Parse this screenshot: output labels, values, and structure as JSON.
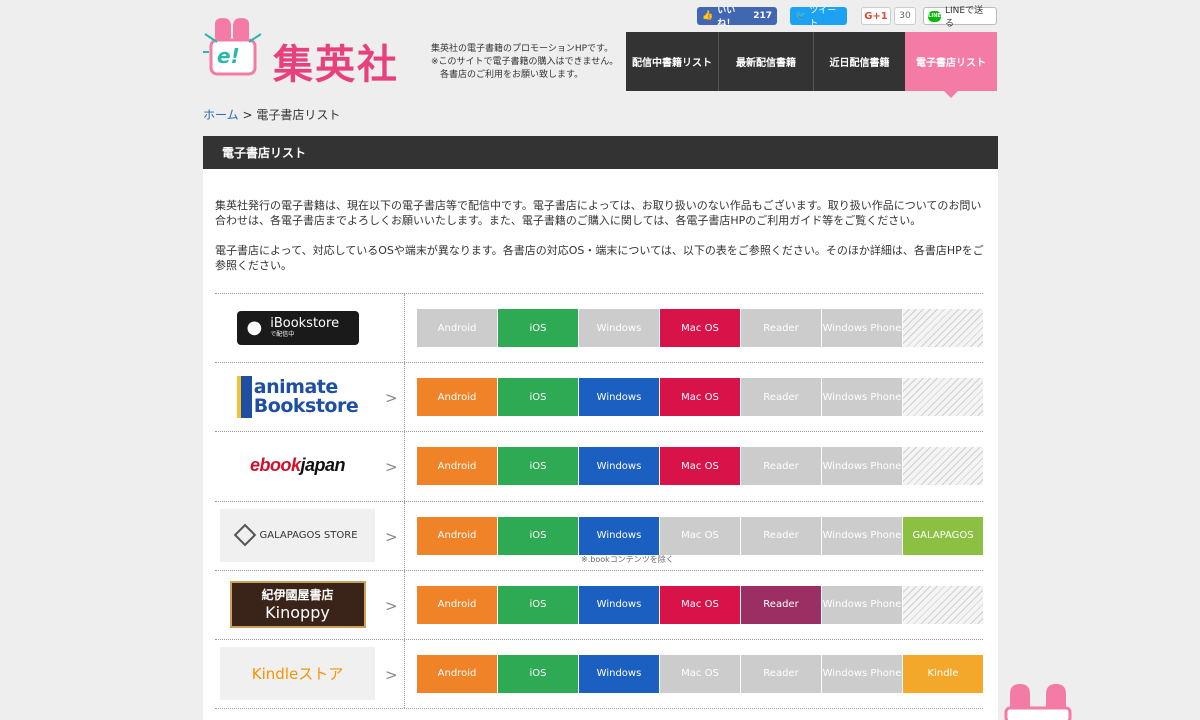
{
  "header": {
    "logo_text": "集英社",
    "logo_badge": "e!",
    "tagline": [
      "集英社の電子書籍のプロモーションHPです。",
      "※このサイトで電子書籍の購入はできません。",
      "　各書店のご利用をお願い致します。"
    ],
    "social": {
      "like_label": "いいね！",
      "like_count": "217",
      "tweet_label": "ツイート",
      "gplus_label": "G+1",
      "gplus_count": "30",
      "line_label": "LINEで送る",
      "line_badge": "LINE"
    },
    "nav": [
      {
        "label": "配信中書籍リスト",
        "width": 92
      },
      {
        "label": "最新配信書籍",
        "width": 95
      },
      {
        "label": "近日配信書籍",
        "width": 92
      },
      {
        "label": "電子書店リスト",
        "width": 92,
        "active": true
      }
    ]
  },
  "breadcrumb": {
    "home": "ホーム",
    "separator": " > ",
    "current": "電子書店リスト"
  },
  "main": {
    "section_title": "電子書店リスト",
    "intro_1": "集英社発行の電子書籍は、現在以下の電子書店等で配信中です。電子書店によっては、お取り扱いのない作品もございます。取り扱い作品についてのお問い合わせは、各電子書店までよろしくお願いいたします。また、電子書籍のご購入に関しては、各電子書店HPのご利用ガイド等をご覧ください。",
    "intro_2": "電子書店によって、対応しているOSや端末が異なります。各書店の対応OS・端末については、以下の表をご参照ください。そのほか詳細は、各書店HPをご参照ください。"
  },
  "colors": {
    "android": "#f08228",
    "ios": "#2eaa55",
    "windows": "#1b5fc1",
    "macos": "#d8134a",
    "reader": "#9b2f63",
    "disabled": "#cccccc",
    "galapagos": "#8cc043",
    "kindle": "#f3a82b",
    "accent": "#f47ba6",
    "dark": "#333333"
  },
  "stores": [
    {
      "key": "ibooks",
      "logo_line1": "iBookstore",
      "logo_line2": "で配信中",
      "has_chevron": false,
      "platforms": [
        {
          "label": "Android",
          "state": "disabled"
        },
        {
          "label": "iOS",
          "state": "ios"
        },
        {
          "label": "Windows",
          "state": "disabled"
        },
        {
          "label": "Mac OS",
          "state": "macos"
        },
        {
          "label": "Reader",
          "state": "disabled"
        },
        {
          "label": "Windows Phone",
          "state": "disabled"
        },
        {
          "label": "",
          "state": "hatch"
        }
      ]
    },
    {
      "key": "animate",
      "logo_line1": "animate",
      "logo_line2": "Bookstore",
      "has_chevron": true,
      "platforms": [
        {
          "label": "Android",
          "state": "android"
        },
        {
          "label": "iOS",
          "state": "ios"
        },
        {
          "label": "Windows",
          "state": "windows"
        },
        {
          "label": "Mac OS",
          "state": "macos"
        },
        {
          "label": "Reader",
          "state": "disabled"
        },
        {
          "label": "Windows Phone",
          "state": "disabled"
        },
        {
          "label": "",
          "state": "hatch"
        }
      ]
    },
    {
      "key": "ebookjapan",
      "logo_line1": "ebook",
      "logo_line2": "japan",
      "has_chevron": true,
      "platforms": [
        {
          "label": "Android",
          "state": "android"
        },
        {
          "label": "iOS",
          "state": "ios"
        },
        {
          "label": "Windows",
          "state": "windows"
        },
        {
          "label": "Mac OS",
          "state": "macos"
        },
        {
          "label": "Reader",
          "state": "disabled"
        },
        {
          "label": "Windows Phone",
          "state": "disabled"
        },
        {
          "label": "",
          "state": "hatch"
        }
      ]
    },
    {
      "key": "galapagos",
      "logo_line1": "GALAPAGOS STORE",
      "has_chevron": true,
      "note": "※.bookコンテンツを除く",
      "platforms": [
        {
          "label": "Android",
          "state": "android"
        },
        {
          "label": "iOS",
          "state": "ios"
        },
        {
          "label": "Windows",
          "state": "windows"
        },
        {
          "label": "Mac OS",
          "state": "disabled"
        },
        {
          "label": "Reader",
          "state": "disabled"
        },
        {
          "label": "Windows Phone",
          "state": "disabled"
        },
        {
          "label": "GALAPAGOS",
          "state": "galapagos"
        }
      ]
    },
    {
      "key": "kinoppy",
      "logo_line1": "紀伊國屋書店",
      "logo_line2": "Kinoppy",
      "has_chevron": true,
      "platforms": [
        {
          "label": "Android",
          "state": "android"
        },
        {
          "label": "iOS",
          "state": "ios"
        },
        {
          "label": "Windows",
          "state": "windows"
        },
        {
          "label": "Mac OS",
          "state": "macos"
        },
        {
          "label": "Reader",
          "state": "reader"
        },
        {
          "label": "Windows Phone",
          "state": "disabled"
        },
        {
          "label": "",
          "state": "hatch"
        }
      ]
    },
    {
      "key": "kindle",
      "logo_line1": "Kindleストア",
      "has_chevron": true,
      "platforms": [
        {
          "label": "Android",
          "state": "android"
        },
        {
          "label": "iOS",
          "state": "ios"
        },
        {
          "label": "Windows",
          "state": "windows"
        },
        {
          "label": "Mac OS",
          "state": "disabled"
        },
        {
          "label": "Reader",
          "state": "disabled"
        },
        {
          "label": "Windows Phone",
          "state": "disabled"
        },
        {
          "label": "Kindle",
          "state": "kindle"
        }
      ]
    }
  ]
}
